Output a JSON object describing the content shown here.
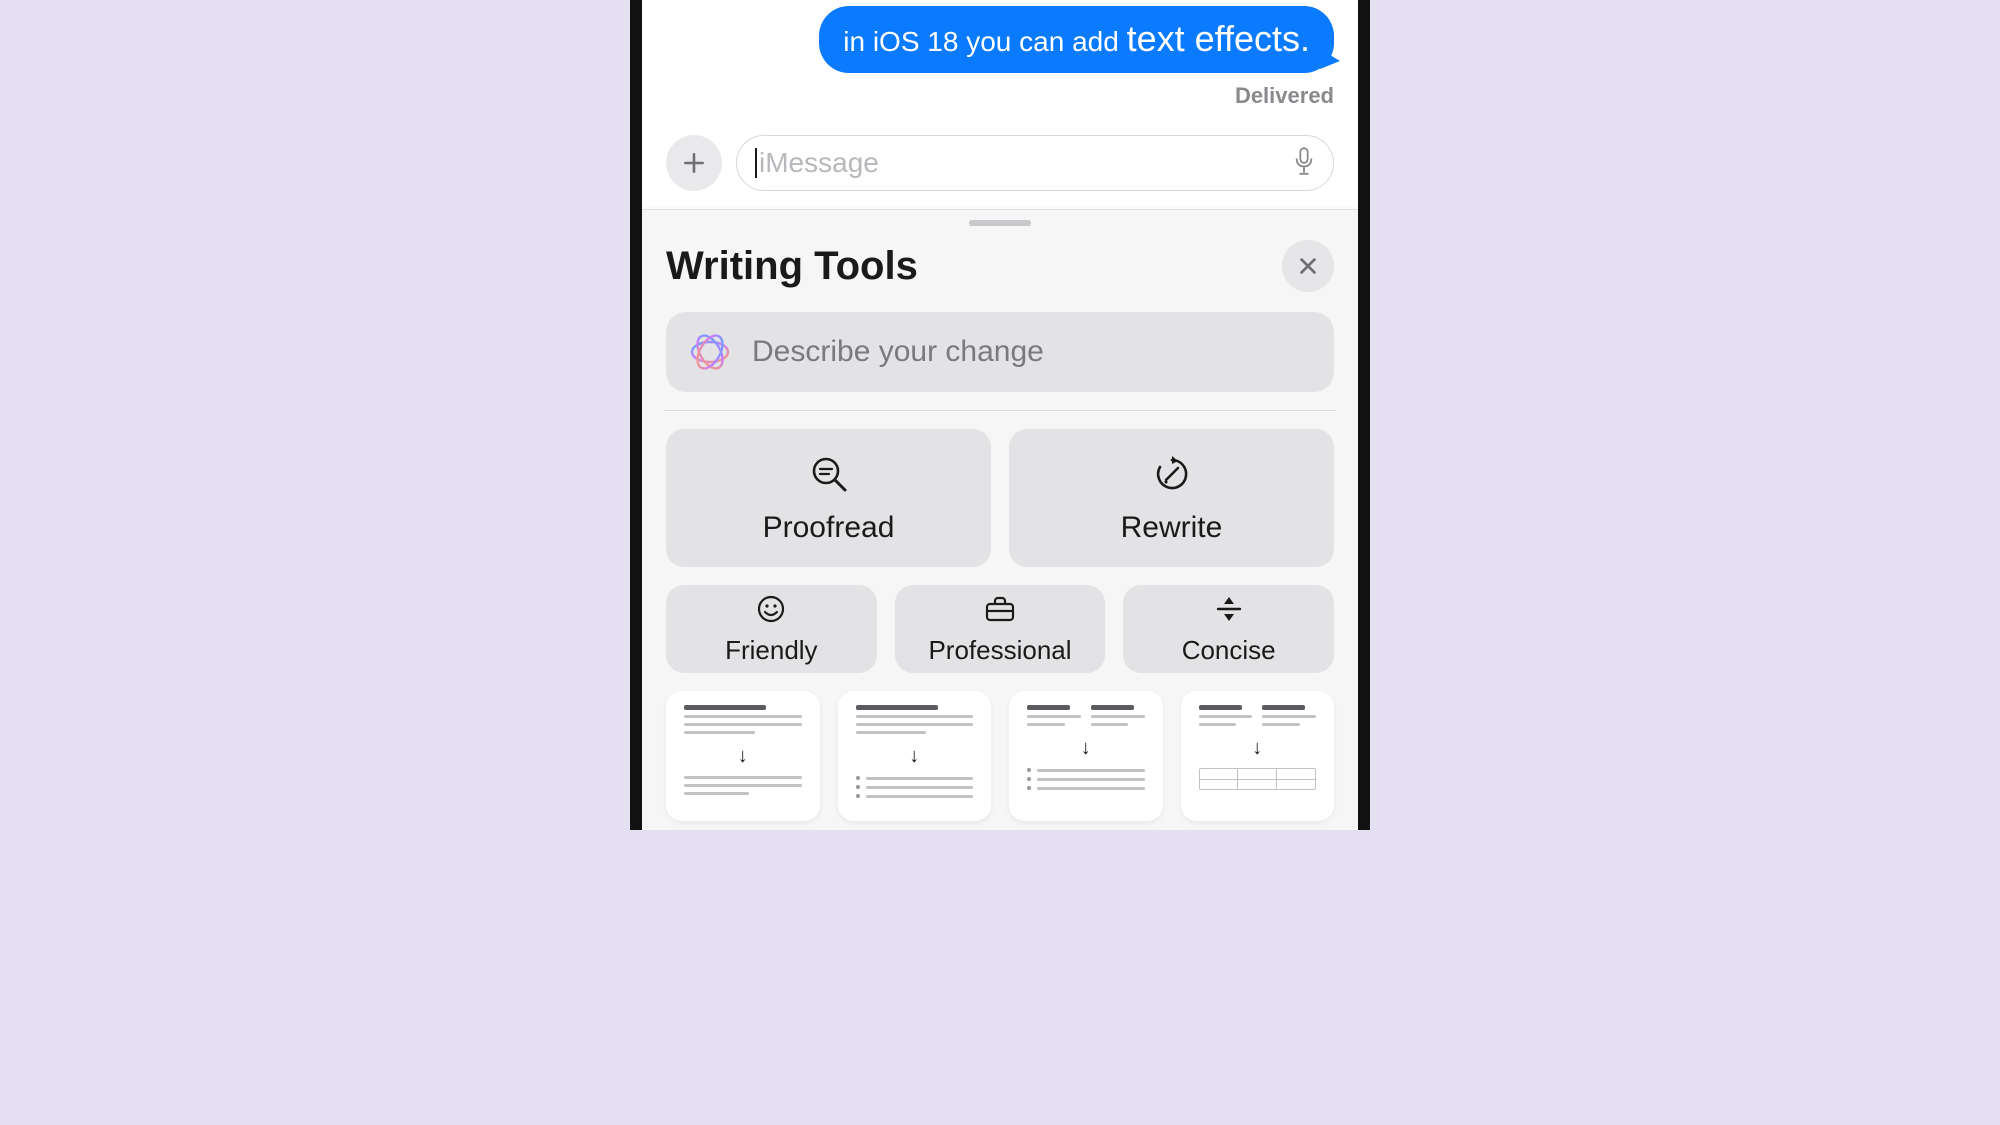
{
  "chat": {
    "bubble_prefix": "in iOS 18 you can add ",
    "bubble_emphasis": "text effects.",
    "status": "Delivered"
  },
  "input": {
    "placeholder": "iMessage"
  },
  "sheet": {
    "title": "Writing Tools",
    "describe_placeholder": "Describe your change",
    "tiles_big": [
      {
        "label": "Proofread"
      },
      {
        "label": "Rewrite"
      }
    ],
    "tiles_small": [
      {
        "label": "Friendly"
      },
      {
        "label": "Professional"
      },
      {
        "label": "Concise"
      }
    ]
  },
  "colors": {
    "imessage_blue": "#0a7aff",
    "page_bg": "#e4dff1"
  }
}
